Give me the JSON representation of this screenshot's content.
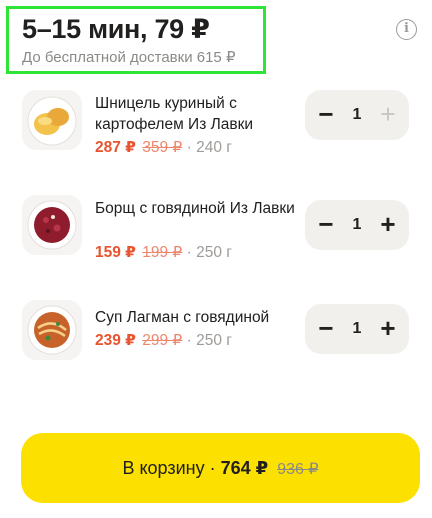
{
  "header": {
    "title": "5–15 мин, 79 ₽",
    "subtitle": "До бесплатной доставки 615 ₽"
  },
  "info_icon": "info-icon",
  "items": [
    {
      "name": "Шницель куриный с картофелем Из Лавки",
      "price": "287 ₽",
      "old_price": "359 ₽",
      "weight": "· 240 г",
      "quantity": "1",
      "minus": "−",
      "plus": "+",
      "plus_disabled": true,
      "image": "schnitzel-with-potatoes-image"
    },
    {
      "name": "Борщ с говядиной Из Лавки",
      "price": "159 ₽",
      "old_price": "199 ₽",
      "weight": "· 250 г",
      "quantity": "1",
      "minus": "−",
      "plus": "+",
      "plus_disabled": false,
      "image": "borscht-image"
    },
    {
      "name": "Суп Лагман с говядиной",
      "price": "239 ₽",
      "old_price": "299 ₽",
      "weight": "· 250 г",
      "quantity": "1",
      "minus": "−",
      "plus": "+",
      "plus_disabled": false,
      "image": "lagman-soup-image"
    }
  ],
  "cart_button": {
    "label": "В корзину",
    "separator": "·",
    "total": "764 ₽",
    "old_total": "936 ₽"
  },
  "colors": {
    "accent_yellow": "#fce000",
    "price_red": "#e8542f",
    "highlight_green": "#2ee536"
  }
}
